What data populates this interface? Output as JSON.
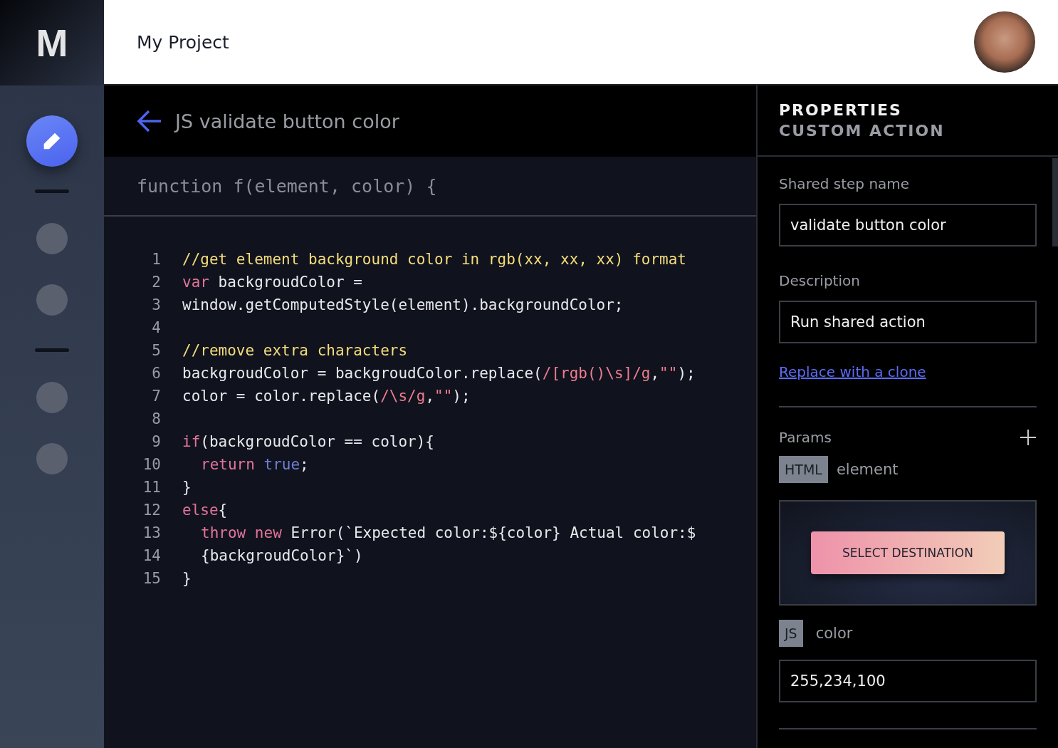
{
  "header": {
    "logo": "M",
    "project": "My Project"
  },
  "nav": [
    {
      "kind": "button",
      "selected": true
    },
    {
      "kind": "divider"
    },
    {
      "kind": "dot",
      "selected": false
    },
    {
      "kind": "dot",
      "selected": false
    },
    {
      "kind": "divider"
    },
    {
      "kind": "dot",
      "selected": false
    },
    {
      "kind": "dot",
      "selected": false
    }
  ],
  "editor": {
    "title": "JS validate button color",
    "signature": "function f(element, color) {",
    "lines": [
      {
        "number": "1",
        "tokens": [
          {
            "kind": "comment",
            "text": "//get element background color in rgb(xx, xx, xx) format"
          }
        ]
      },
      {
        "number": "2",
        "tokens": [
          {
            "kind": "keyword",
            "text": "var"
          },
          {
            "kind": "plain",
            "text": " backgroudColor ="
          }
        ]
      },
      {
        "number": "3",
        "tokens": [
          {
            "kind": "plain",
            "text": "window.getComputedStyle(element).backgroundColor;"
          }
        ]
      },
      {
        "number": "4"
      },
      {
        "number": "5",
        "tokens": [
          {
            "kind": "comment",
            "text": "//remove extra characters"
          }
        ]
      },
      {
        "number": "6",
        "tokens": [
          {
            "kind": "plain",
            "text": "backgroudColor = backgroudColor.replace("
          },
          {
            "kind": "string",
            "text": "/[rgb()\\s]/g"
          },
          {
            "kind": "plain",
            "text": ","
          },
          {
            "kind": "string",
            "text": "\"\""
          },
          {
            "kind": "plain",
            "text": ");"
          }
        ]
      },
      {
        "number": "7",
        "tokens": [
          {
            "kind": "plain",
            "text": "color = color.replace("
          },
          {
            "kind": "string",
            "text": "/\\s/g"
          },
          {
            "kind": "plain",
            "text": ","
          },
          {
            "kind": "string",
            "text": "\"\""
          },
          {
            "kind": "plain",
            "text": ");"
          }
        ]
      },
      {
        "number": "8"
      },
      {
        "number": "9",
        "tokens": [
          {
            "kind": "keyword",
            "text": "if"
          },
          {
            "kind": "plain",
            "text": "(backgroudColor == color){"
          }
        ]
      },
      {
        "number": "10",
        "indented": true,
        "tokens": [
          {
            "kind": "keyword",
            "text": "return"
          },
          {
            "kind": "literal",
            "text": " true"
          },
          {
            "kind": "plain",
            "text": ";"
          }
        ]
      },
      {
        "number": "11",
        "tokens": [
          {
            "kind": "plain",
            "text": "}"
          }
        ]
      },
      {
        "number": "12",
        "tokens": [
          {
            "kind": "keyword",
            "text": "else"
          },
          {
            "kind": "plain",
            "text": "{"
          }
        ]
      },
      {
        "number": "13",
        "indented": true,
        "tokens": [
          {
            "kind": "keyword",
            "text": "throw new"
          },
          {
            "kind": "plain",
            "text": " Error(`Expected color:${color} Actual color:$"
          }
        ]
      },
      {
        "number": "14",
        "indented": true,
        "tokens": [
          {
            "kind": "plain",
            "text": "{backgroudColor}`)"
          }
        ]
      },
      {
        "number": "15",
        "tokens": [
          {
            "kind": "plain",
            "text": "}"
          }
        ]
      }
    ]
  },
  "properties": {
    "title": "PROPERTIES",
    "subtitle": "CUSTOM ACTION",
    "fields": [
      {
        "label": "Shared step name",
        "value": "validate button color"
      },
      {
        "label": "Description",
        "value": "Run shared action"
      }
    ],
    "link": "Replace with a clone",
    "params_label": "Params",
    "params": [
      {
        "kind": "element",
        "type": "HTML",
        "name": "element",
        "preview_button": "SELECT DESTINATION"
      },
      {
        "kind": "value",
        "type": "JS",
        "name": "color",
        "value": "255,234,100"
      }
    ]
  }
}
